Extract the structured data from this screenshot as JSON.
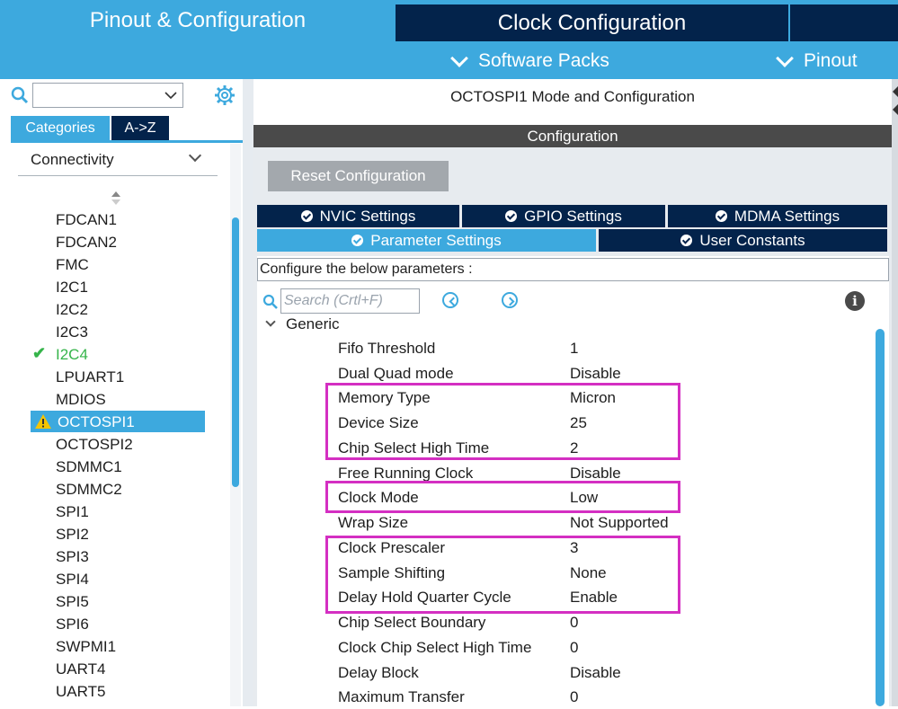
{
  "header": {
    "tab_pinout": "Pinout & Configuration",
    "tab_clock": "Clock Configuration",
    "nav_software_packs": "Software Packs",
    "nav_pinout": "Pinout"
  },
  "sidebar": {
    "search_value": "",
    "tab_categories": "Categories",
    "tab_az": "A->Z",
    "category": "Connectivity",
    "items": [
      {
        "label": "FDCAN1",
        "status": "none"
      },
      {
        "label": "FDCAN2",
        "status": "none"
      },
      {
        "label": "FMC",
        "status": "none"
      },
      {
        "label": "I2C1",
        "status": "none"
      },
      {
        "label": "I2C2",
        "status": "none"
      },
      {
        "label": "I2C3",
        "status": "none"
      },
      {
        "label": "I2C4",
        "status": "ok"
      },
      {
        "label": "LPUART1",
        "status": "none"
      },
      {
        "label": "MDIOS",
        "status": "none"
      },
      {
        "label": "OCTOSPI1",
        "status": "warning-selected"
      },
      {
        "label": "OCTOSPI2",
        "status": "none"
      },
      {
        "label": "SDMMC1",
        "status": "none"
      },
      {
        "label": "SDMMC2",
        "status": "none"
      },
      {
        "label": "SPI1",
        "status": "none"
      },
      {
        "label": "SPI2",
        "status": "none"
      },
      {
        "label": "SPI3",
        "status": "none"
      },
      {
        "label": "SPI4",
        "status": "none"
      },
      {
        "label": "SPI5",
        "status": "none"
      },
      {
        "label": "SPI6",
        "status": "none"
      },
      {
        "label": "SWPMI1",
        "status": "none"
      },
      {
        "label": "UART4",
        "status": "none"
      },
      {
        "label": "UART5",
        "status": "none"
      }
    ]
  },
  "main": {
    "mode_title": "OCTOSPI1 Mode and Configuration",
    "config_header": "Configuration",
    "reset_button": "Reset Configuration",
    "tabs": {
      "nvic": "NVIC Settings",
      "gpio": "GPIO Settings",
      "mdma": "MDMA Settings",
      "param": "Parameter Settings",
      "user_constants": "User Constants"
    },
    "configure_label": "Configure the below parameters :",
    "search_placeholder": "Search (Crtl+F)",
    "info_glyph": "i",
    "group_label": "Generic",
    "params": [
      {
        "name": "Fifo Threshold",
        "value": "1"
      },
      {
        "name": "Dual Quad mode",
        "value": "Disable"
      },
      {
        "name": "Memory Type",
        "value": "Micron"
      },
      {
        "name": "Device Size",
        "value": "25"
      },
      {
        "name": "Chip Select High Time",
        "value": "2"
      },
      {
        "name": "Free Running Clock",
        "value": "Disable"
      },
      {
        "name": "Clock Mode",
        "value": "Low"
      },
      {
        "name": "Wrap Size",
        "value": "Not Supported"
      },
      {
        "name": "Clock Prescaler",
        "value": "3"
      },
      {
        "name": "Sample Shifting",
        "value": "None"
      },
      {
        "name": "Delay Hold Quarter Cycle",
        "value": "Enable"
      },
      {
        "name": "Chip Select Boundary",
        "value": "0"
      },
      {
        "name": "Clock Chip Select High Time",
        "value": "0"
      },
      {
        "name": "Delay Block",
        "value": "Disable"
      },
      {
        "name": "Maximum Transfer",
        "value": "0"
      }
    ]
  },
  "colors": {
    "accent_blue": "#3da9de",
    "navy": "#03234b",
    "ok_green": "#35b44a",
    "warning_yellow": "#f5c400",
    "highlight_magenta": "#d42fc2"
  },
  "icons": {
    "search": "search-icon",
    "gear": "gear-icon",
    "check": "check-icon",
    "warning": "warning-icon",
    "info": "info-icon",
    "chevron": "chevron-down-icon"
  }
}
